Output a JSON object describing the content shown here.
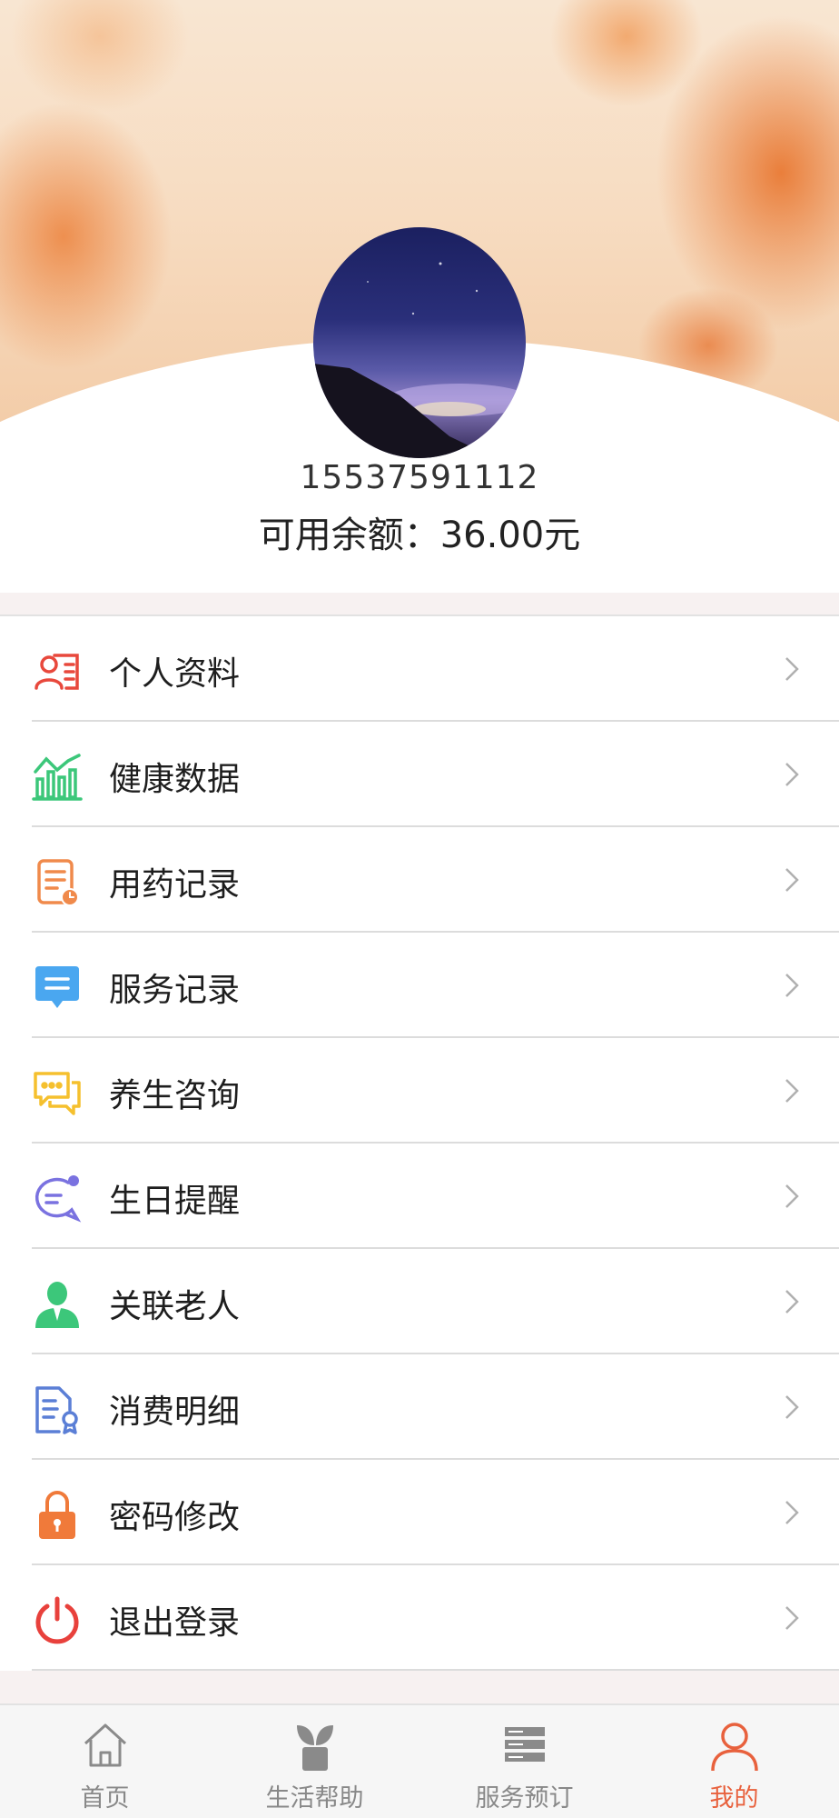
{
  "profile": {
    "phone": "15537591112",
    "balance_text": "可用余额：36.00元"
  },
  "menu": [
    {
      "label": "个人资料",
      "icon": "profile-card-icon",
      "color": "#e8483c"
    },
    {
      "label": "健康数据",
      "icon": "bar-chart-icon",
      "color": "#3cc77a"
    },
    {
      "label": "用药记录",
      "icon": "document-clock-icon",
      "color": "#f08a4b"
    },
    {
      "label": "服务记录",
      "icon": "chat-bubble-icon",
      "color": "#4aa7f0"
    },
    {
      "label": "养生咨询",
      "icon": "speech-bubbles-icon",
      "color": "#f5c02e"
    },
    {
      "label": "生日提醒",
      "icon": "message-dot-icon",
      "color": "#7a72e0"
    },
    {
      "label": "关联老人",
      "icon": "person-icon",
      "color": "#3cc77a"
    },
    {
      "label": "消费明细",
      "icon": "receipt-badge-icon",
      "color": "#5b7fd6"
    },
    {
      "label": "密码修改",
      "icon": "padlock-icon",
      "color": "#f07a3a"
    },
    {
      "label": "退出登录",
      "icon": "power-icon",
      "color": "#e8413c"
    }
  ],
  "tabbar": {
    "items": [
      {
        "label": "首页",
        "icon": "home-icon",
        "active": false
      },
      {
        "label": "生活帮助",
        "icon": "plant-pot-icon",
        "active": false
      },
      {
        "label": "服务预订",
        "icon": "server-stack-icon",
        "active": false
      },
      {
        "label": "我的",
        "icon": "user-icon",
        "active": true
      }
    ],
    "active_color": "#e8613d",
    "inactive_color": "#888888"
  }
}
